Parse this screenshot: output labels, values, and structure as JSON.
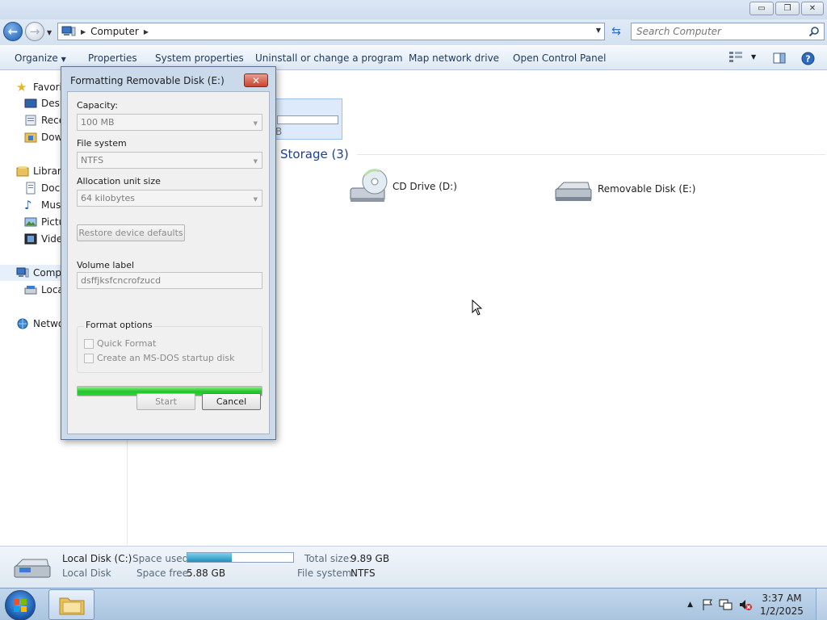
{
  "window": {
    "minimize_glyph": "▭",
    "maximize_glyph": "❐",
    "close_glyph": "✕"
  },
  "address": {
    "back_glyph": "←",
    "forward_glyph": "→",
    "path_label": "Computer",
    "search_placeholder": "Search Computer"
  },
  "commands": {
    "organize": "Organize",
    "properties": "Properties",
    "system_properties": "System properties",
    "uninstall": "Uninstall or change a program",
    "map_drive": "Map network drive",
    "control_panel": "Open Control Panel"
  },
  "nav": {
    "favorites": "Favorit",
    "desktop": "Desk",
    "recent": "Rece",
    "downloads": "Dow",
    "libraries": "Librari",
    "documents": "Docu",
    "music": "Mus",
    "pictures": "Pictu",
    "videos": "Vide",
    "computer": "Comp",
    "local_disk": "Loca",
    "network": "Netwo"
  },
  "content": {
    "group_header": "Storage (3)",
    "selected_tile_partial": "B",
    "cd_drive": "CD Drive (D:)",
    "removable": "Removable Disk (E:)"
  },
  "details": {
    "name": "Local Disk (C:)",
    "type": "Local Disk",
    "space_used_label": "Space used:",
    "space_used_fraction": 0.42,
    "space_free_label": "Space free:",
    "space_free_value": "5.88 GB",
    "total_size_label": "Total size:",
    "total_size_value": "9.89 GB",
    "file_system_label": "File system:",
    "file_system_value": "NTFS"
  },
  "dialog": {
    "title": "Formatting Removable Disk (E:)",
    "close_glyph": "✕",
    "capacity_label": "Capacity:",
    "capacity_value": "100 MB",
    "fs_label": "File system",
    "fs_value": "NTFS",
    "alloc_label": "Allocation unit size",
    "alloc_value": "64 kilobytes",
    "restore_label": "Restore device defaults",
    "volume_label": "Volume label",
    "volume_value": "dsffjksfcncrofzucd",
    "format_options": "Format options",
    "quick_format": "Quick Format",
    "msdos": "Create an MS-DOS startup disk",
    "progress_fraction": 1.0,
    "start_label": "Start",
    "cancel_label": "Cancel"
  },
  "taskbar": {
    "tray_arrow": "▲",
    "time": "3:37 AM",
    "date": "1/2/2025"
  },
  "colors": {
    "accent": "#1e3f8f",
    "progress_green": "#22c42a",
    "space_fill": "#1f8fbd"
  }
}
